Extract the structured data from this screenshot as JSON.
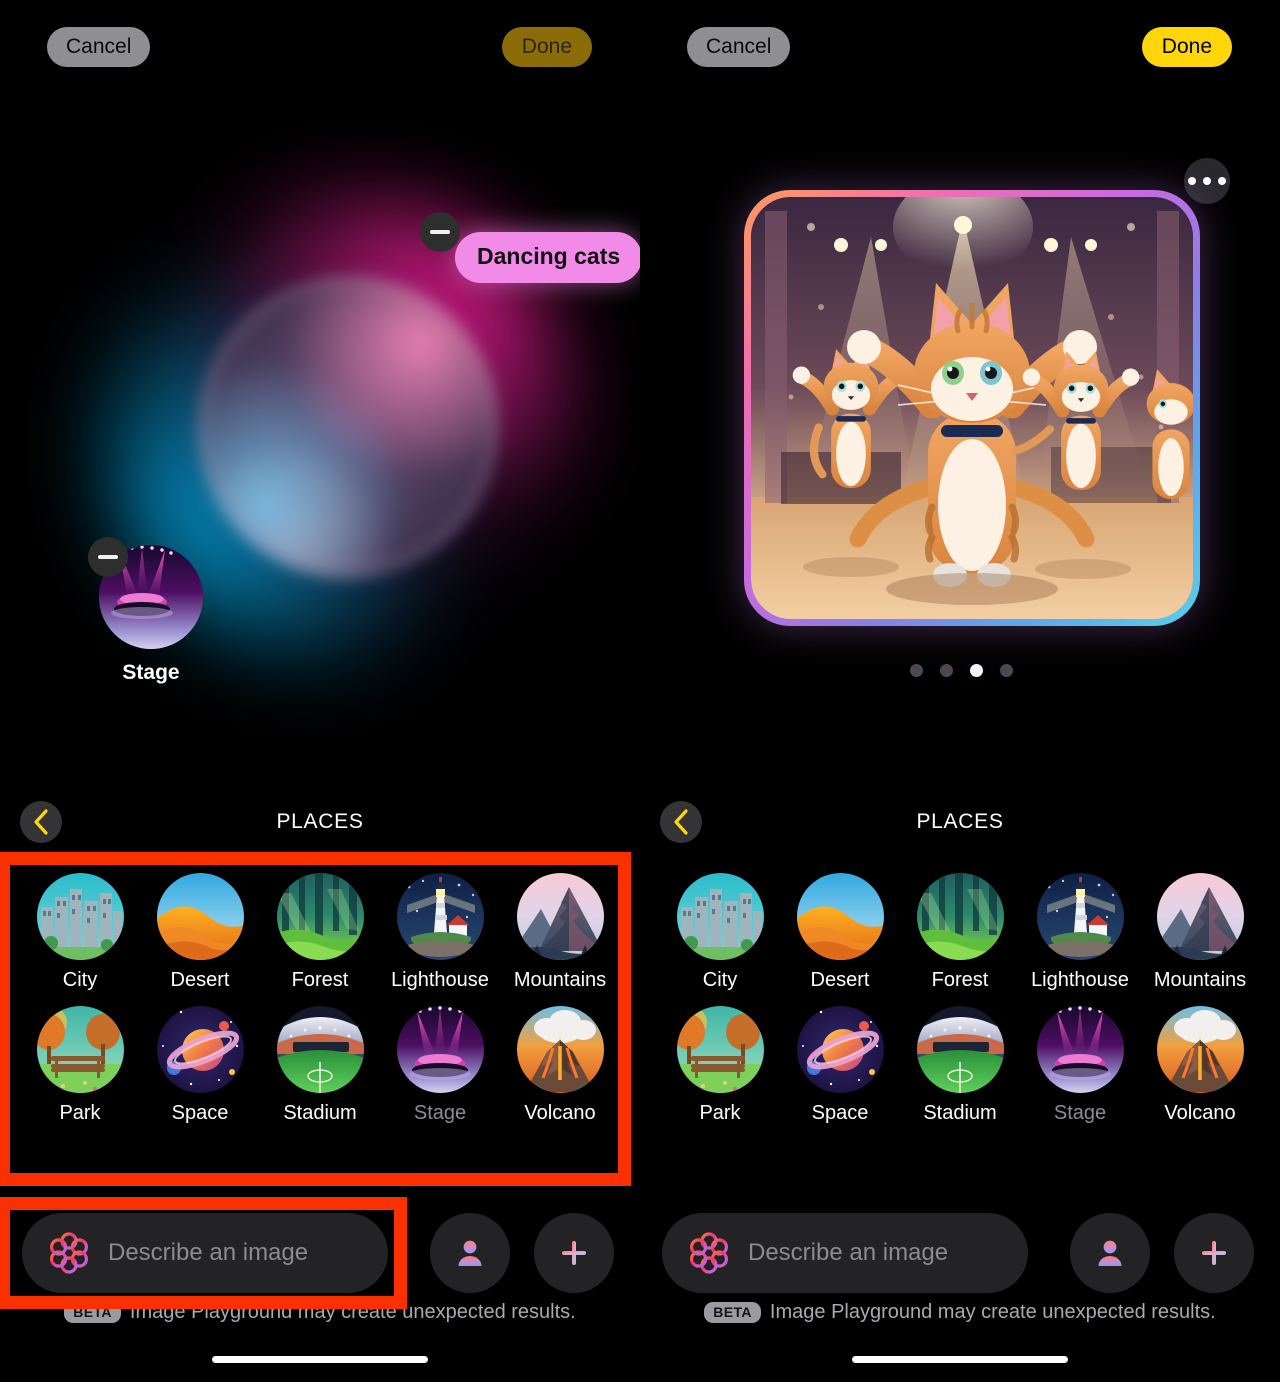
{
  "app": {
    "name": "Image Playground"
  },
  "panels": [
    {
      "id": "left",
      "topbar": {
        "cancel_label": "Cancel",
        "done_label": "Done",
        "done_enabled": false
      },
      "canvas": {
        "prompt_chip": {
          "label": "Dancing cats",
          "color": "#f28be8",
          "removable": true
        },
        "concept_chip": {
          "label": "Stage",
          "removable": true
        }
      },
      "places": {
        "title": "PLACES",
        "back_icon": "chevron-left-icon",
        "items": [
          {
            "label": "City",
            "icon": "city-thumbnail",
            "selected": false
          },
          {
            "label": "Desert",
            "icon": "desert-thumbnail",
            "selected": false
          },
          {
            "label": "Forest",
            "icon": "forest-thumbnail",
            "selected": false
          },
          {
            "label": "Lighthouse",
            "icon": "lighthouse-thumbnail",
            "selected": false
          },
          {
            "label": "Mountains",
            "icon": "mountains-thumbnail",
            "selected": false
          },
          {
            "label": "Park",
            "icon": "park-thumbnail",
            "selected": false
          },
          {
            "label": "Space",
            "icon": "space-thumbnail",
            "selected": false
          },
          {
            "label": "Stadium",
            "icon": "stadium-thumbnail",
            "selected": false
          },
          {
            "label": "Stage",
            "icon": "stage-thumbnail",
            "selected": true
          },
          {
            "label": "Volcano",
            "icon": "volcano-thumbnail",
            "selected": false
          }
        ]
      },
      "inputbar": {
        "placeholder": "Describe an image",
        "value": "",
        "ai_icon": "apple-intelligence-icon",
        "people_icon": "person-icon",
        "add_icon": "plus-icon"
      },
      "footer": {
        "badge": "BETA",
        "text": "Image Playground may create unexpected results."
      }
    },
    {
      "id": "right",
      "topbar": {
        "cancel_label": "Cancel",
        "done_label": "Done",
        "done_enabled": true
      },
      "canvas": {
        "more_icon": "ellipsis-icon",
        "generated_image": "dancing-cats-on-stage",
        "page_dots": {
          "count": 4,
          "active_index": 2
        }
      },
      "places": {
        "title": "PLACES",
        "back_icon": "chevron-left-icon",
        "items": [
          {
            "label": "City",
            "icon": "city-thumbnail",
            "selected": false
          },
          {
            "label": "Desert",
            "icon": "desert-thumbnail",
            "selected": false
          },
          {
            "label": "Forest",
            "icon": "forest-thumbnail",
            "selected": false
          },
          {
            "label": "Lighthouse",
            "icon": "lighthouse-thumbnail",
            "selected": false
          },
          {
            "label": "Mountains",
            "icon": "mountains-thumbnail",
            "selected": false
          },
          {
            "label": "Park",
            "icon": "park-thumbnail",
            "selected": false
          },
          {
            "label": "Space",
            "icon": "space-thumbnail",
            "selected": false
          },
          {
            "label": "Stadium",
            "icon": "stadium-thumbnail",
            "selected": false
          },
          {
            "label": "Stage",
            "icon": "stage-thumbnail",
            "selected": true
          },
          {
            "label": "Volcano",
            "icon": "volcano-thumbnail",
            "selected": false
          }
        ]
      },
      "inputbar": {
        "placeholder": "Describe an image",
        "value": "",
        "ai_icon": "apple-intelligence-icon",
        "people_icon": "person-icon",
        "add_icon": "plus-icon"
      },
      "footer": {
        "badge": "BETA",
        "text": "Image Playground may create unexpected results."
      }
    }
  ],
  "annotations": [
    {
      "name": "places-grid-highlight",
      "color": "#fa3000"
    },
    {
      "name": "prompt-input-highlight",
      "color": "#fa3000"
    }
  ],
  "colors": {
    "done_enabled": "#ffd60a",
    "done_disabled": "#8a6d07",
    "cancel": "#8e8e93",
    "prompt_chip": "#f28be8",
    "annotation": "#fa3000",
    "background": "#000000"
  }
}
